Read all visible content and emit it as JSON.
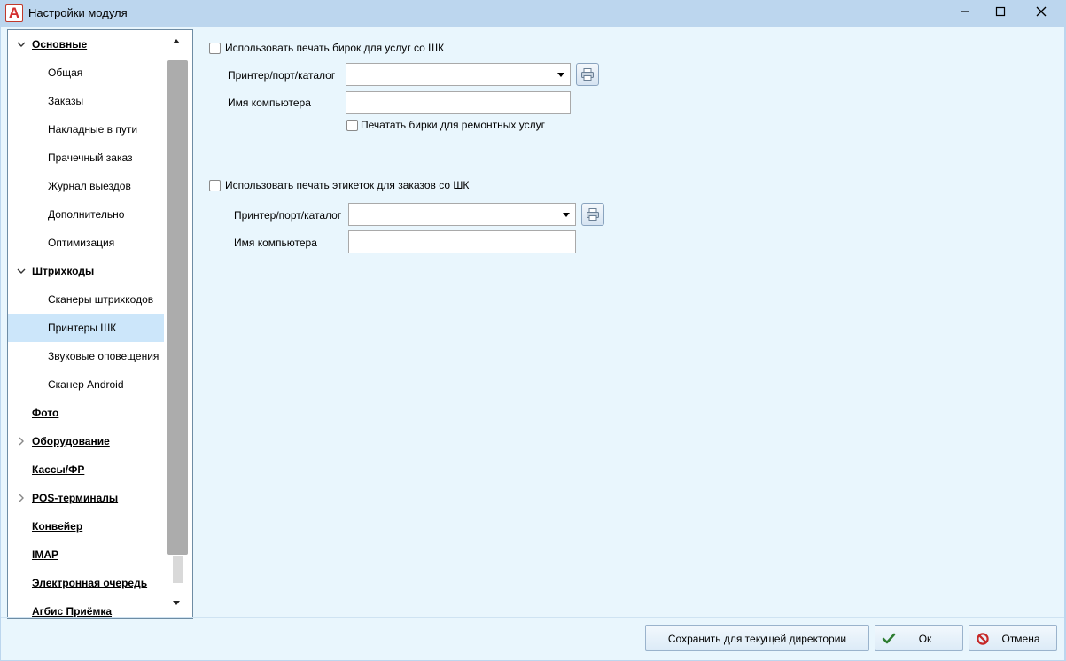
{
  "window": {
    "title": "Настройки модуля",
    "app_icon_letter": "A"
  },
  "tree": {
    "items": [
      {
        "label": "Основные",
        "level": "parent",
        "expanded": true
      },
      {
        "label": "Общая",
        "level": "child"
      },
      {
        "label": "Заказы",
        "level": "child"
      },
      {
        "label": "Накладные в пути",
        "level": "child"
      },
      {
        "label": "Прачечный заказ",
        "level": "child"
      },
      {
        "label": "Журнал выездов",
        "level": "child"
      },
      {
        "label": "Дополнительно",
        "level": "child"
      },
      {
        "label": "Оптимизация",
        "level": "child"
      },
      {
        "label": "Штрихкоды",
        "level": "parent",
        "expanded": true
      },
      {
        "label": "Сканеры штрихкодов",
        "level": "child"
      },
      {
        "label": "Принтеры ШК",
        "level": "child",
        "selected": true
      },
      {
        "label": "Звуковые оповещения",
        "level": "child"
      },
      {
        "label": "Сканер Android",
        "level": "child"
      },
      {
        "label": "Фото",
        "level": "parent"
      },
      {
        "label": "Оборудование",
        "level": "parent",
        "expanded": false
      },
      {
        "label": "Кассы/ФР",
        "level": "parent"
      },
      {
        "label": "POS-терминалы",
        "level": "parent",
        "expanded": false
      },
      {
        "label": "Конвейер",
        "level": "parent"
      },
      {
        "label": "IMAP",
        "level": "parent"
      },
      {
        "label": "Электронная очередь",
        "level": "parent"
      },
      {
        "label": "Агбис Приёмка",
        "level": "parent"
      }
    ]
  },
  "section_tags": {
    "checkbox_label": "Использовать печать бирок для услуг со ШК",
    "checked": false,
    "printer_label": "Принтер/порт/каталог",
    "printer_value": "",
    "computer_label": "Имя компьютера",
    "computer_value": "",
    "repair_checkbox_label": "Печатать бирки для ремонтных услуг",
    "repair_checked": false
  },
  "section_labels": {
    "checkbox_label": "Использовать печать этикеток для заказов со ШК",
    "checked": false,
    "printer_label": "Принтер/порт/каталог",
    "printer_value": "",
    "computer_label": "Имя компьютера",
    "computer_value": ""
  },
  "footer": {
    "save_dir_label": "Сохранить для текущей директории",
    "ok_label": "Ок",
    "cancel_label": "Отмена"
  },
  "colors": {
    "accent_check": "#2e7d32",
    "cancel_icon": "#c62828",
    "selected_bg": "#cce6fa"
  }
}
